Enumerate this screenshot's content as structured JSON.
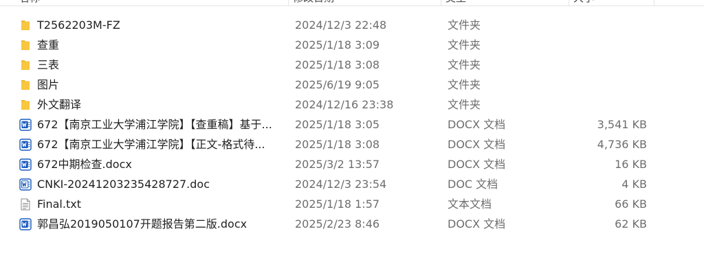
{
  "columns": {
    "name": "名称",
    "modified": "修改日期",
    "type": "类型",
    "size": "大小"
  },
  "files": [
    {
      "name": "T2562203M-FZ",
      "modified": "2024/12/3 22:48",
      "type": "文件夹",
      "size": "",
      "icon": "folder-icon"
    },
    {
      "name": "查重",
      "modified": "2025/1/18 3:09",
      "type": "文件夹",
      "size": "",
      "icon": "folder-icon"
    },
    {
      "name": "三表",
      "modified": "2025/1/18 3:08",
      "type": "文件夹",
      "size": "",
      "icon": "folder-icon"
    },
    {
      "name": "图片",
      "modified": "2025/6/19 9:05",
      "type": "文件夹",
      "size": "",
      "icon": "folder-icon"
    },
    {
      "name": "外文翻译",
      "modified": "2024/12/16 23:38",
      "type": "文件夹",
      "size": "",
      "icon": "folder-icon"
    },
    {
      "name": "672【南京工业大学浦江学院】【查重稿】基于...",
      "modified": "2025/1/18 3:05",
      "type": "DOCX 文档",
      "size": "3,541 KB",
      "icon": "word-doc-icon"
    },
    {
      "name": "672【南京工业大学浦江学院】【正文-格式待...",
      "modified": "2025/1/18 3:08",
      "type": "DOCX 文档",
      "size": "4,736 KB",
      "icon": "word-doc-icon"
    },
    {
      "name": "672中期检查.docx",
      "modified": "2025/3/2 13:57",
      "type": "DOCX 文档",
      "size": "16 KB",
      "icon": "word-doc-icon"
    },
    {
      "name": "CNKI-20241203235428727.doc",
      "modified": "2024/12/3 23:54",
      "type": "DOC 文档",
      "size": "4 KB",
      "icon": "word-legacy-doc-icon"
    },
    {
      "name": "Final.txt",
      "modified": "2025/1/18 1:57",
      "type": "文本文档",
      "size": "66 KB",
      "icon": "text-file-icon"
    },
    {
      "name": "郭昌弘2019050107开题报告第二版.docx",
      "modified": "2025/2/23 8:46",
      "type": "DOCX 文档",
      "size": "62 KB",
      "icon": "word-doc-icon"
    }
  ],
  "colors": {
    "folder": "#f8c640",
    "folder_dark": "#e6a817",
    "word": "#185abd",
    "secondary_text": "#6d6d6d"
  }
}
